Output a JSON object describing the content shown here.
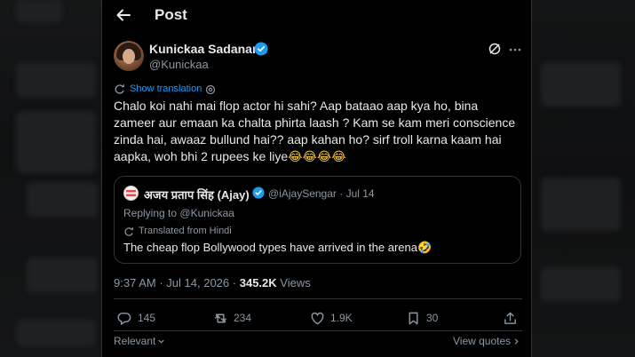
{
  "header": {
    "title": "Post"
  },
  "author": {
    "name": "Kunickaa Sadanand",
    "handle": "@Kunickaa"
  },
  "translation": {
    "show_label": "Show translation"
  },
  "tweet": {
    "text": "Chalo koi nahi mai flop actor hi sahi? Aap bataao aap kya ho, bina zameer aur emaan ka chalta phirta laash ? Kam se kam meri conscience zinda hai, awaaz bullund hai?? aap kahan ho? sirf troll karna kaam hai aapka, woh bhi 2 rupees ke liye",
    "emojis": "😂😂😂😂"
  },
  "quote": {
    "name": "अजय प्रताप सिंह (Ajay)",
    "handle": "@iAjaySengar",
    "separator": "·",
    "date": "Jul 14",
    "replying_prefix": "Replying to",
    "replying_to": "@Kunickaa",
    "translated_label": "Translated from Hindi",
    "text": "The cheap flop Bollywood types have arrived in the arena",
    "emoji": "🤣"
  },
  "meta": {
    "time": "9:37 AM",
    "separator": "·",
    "date": "Jul 14, 2026",
    "separator2": "·",
    "views_count": "345.2K",
    "views_label": "Views"
  },
  "actions": {
    "replies": "145",
    "reposts": "234",
    "likes": "1.9K",
    "bookmarks": "30"
  },
  "footer": {
    "sort_label": "Relevant",
    "view_quotes_label": "View quotes"
  },
  "colors": {
    "accent": "#1d9bf0",
    "text": "#e7e9ea",
    "muted": "#8b98a5",
    "border": "#2f3336"
  },
  "icons": [
    "back-arrow-icon",
    "verified-badge-icon",
    "grok-icon",
    "more-icon",
    "translate-icon",
    "gear-icon",
    "reply-icon",
    "repost-icon",
    "like-icon",
    "bookmark-icon",
    "share-icon",
    "chevron-down-icon",
    "chevron-right-icon"
  ]
}
